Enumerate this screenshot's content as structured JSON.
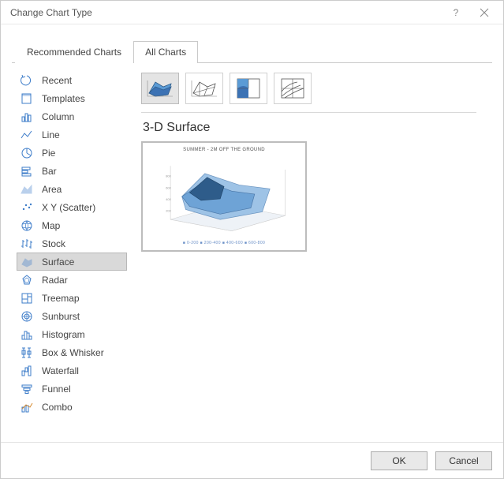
{
  "dialog": {
    "title": "Change Chart Type",
    "help_label": "?",
    "close_label": "×"
  },
  "tabs": {
    "recommended": "Recommended Charts",
    "all": "All Charts"
  },
  "categories": {
    "recent": "Recent",
    "templates": "Templates",
    "column": "Column",
    "line": "Line",
    "pie": "Pie",
    "bar": "Bar",
    "area": "Area",
    "xy": "X Y (Scatter)",
    "map": "Map",
    "stock": "Stock",
    "surface": "Surface",
    "radar": "Radar",
    "treemap": "Treemap",
    "sunburst": "Sunburst",
    "histogram": "Histogram",
    "box": "Box & Whisker",
    "waterfall": "Waterfall",
    "funnel": "Funnel",
    "combo": "Combo"
  },
  "subtype": {
    "title": "3-D Surface"
  },
  "preview": {
    "chart_title": "SUMMER - 2M OFF THE GROUND",
    "legend": "■ 0-200  ■ 200-400  ■ 400-600  ■ 600-800"
  },
  "buttons": {
    "ok": "OK",
    "cancel": "Cancel"
  }
}
